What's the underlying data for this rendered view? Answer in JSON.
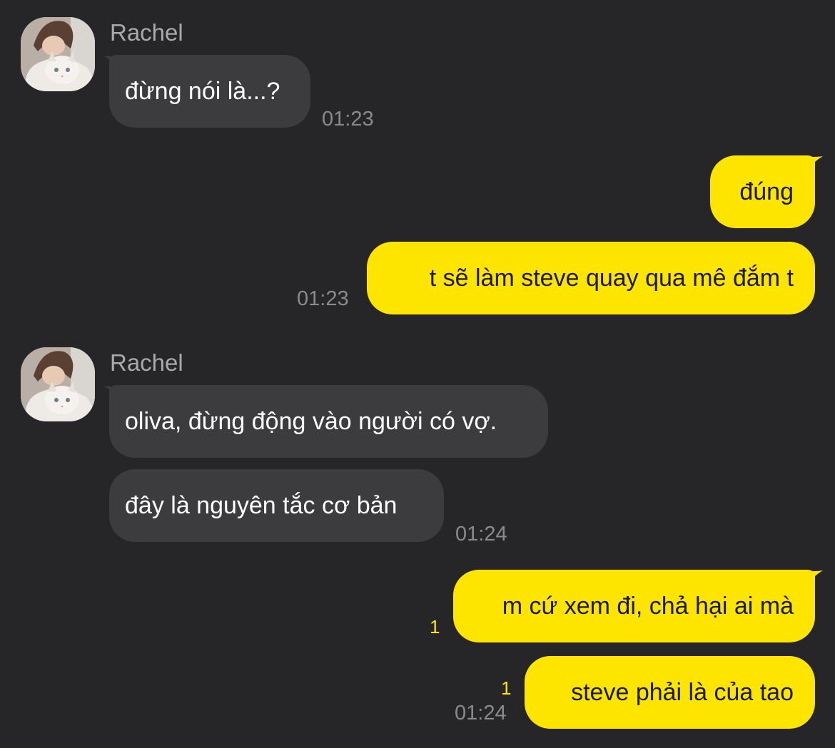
{
  "colors": {
    "background": "#262628",
    "incoming_bubble": "#3c3c3e",
    "outgoing_bubble": "#fee500",
    "unread_count": "#fee500",
    "timestamp": "#8a8a8c"
  },
  "messages": [
    {
      "sender": "Rachel",
      "avatar": "cat-photo-avatar",
      "bubbles": [
        "đừng nói là...?"
      ],
      "time": "01:23"
    },
    {
      "sender": "me",
      "bubbles": [
        "đúng",
        "t sẽ làm steve quay qua mê đắm t"
      ],
      "time": "01:23"
    },
    {
      "sender": "Rachel",
      "avatar": "cat-photo-avatar",
      "bubbles": [
        "oliva, đừng động vào người có vợ.",
        "đây là nguyên tắc cơ bản"
      ],
      "time": "01:24"
    },
    {
      "sender": "me",
      "bubbles": [
        "m cứ xem đi, chả hại ai mà",
        "steve phải là của tao"
      ],
      "unread": [
        "1",
        "1"
      ],
      "time": "01:24"
    }
  ]
}
